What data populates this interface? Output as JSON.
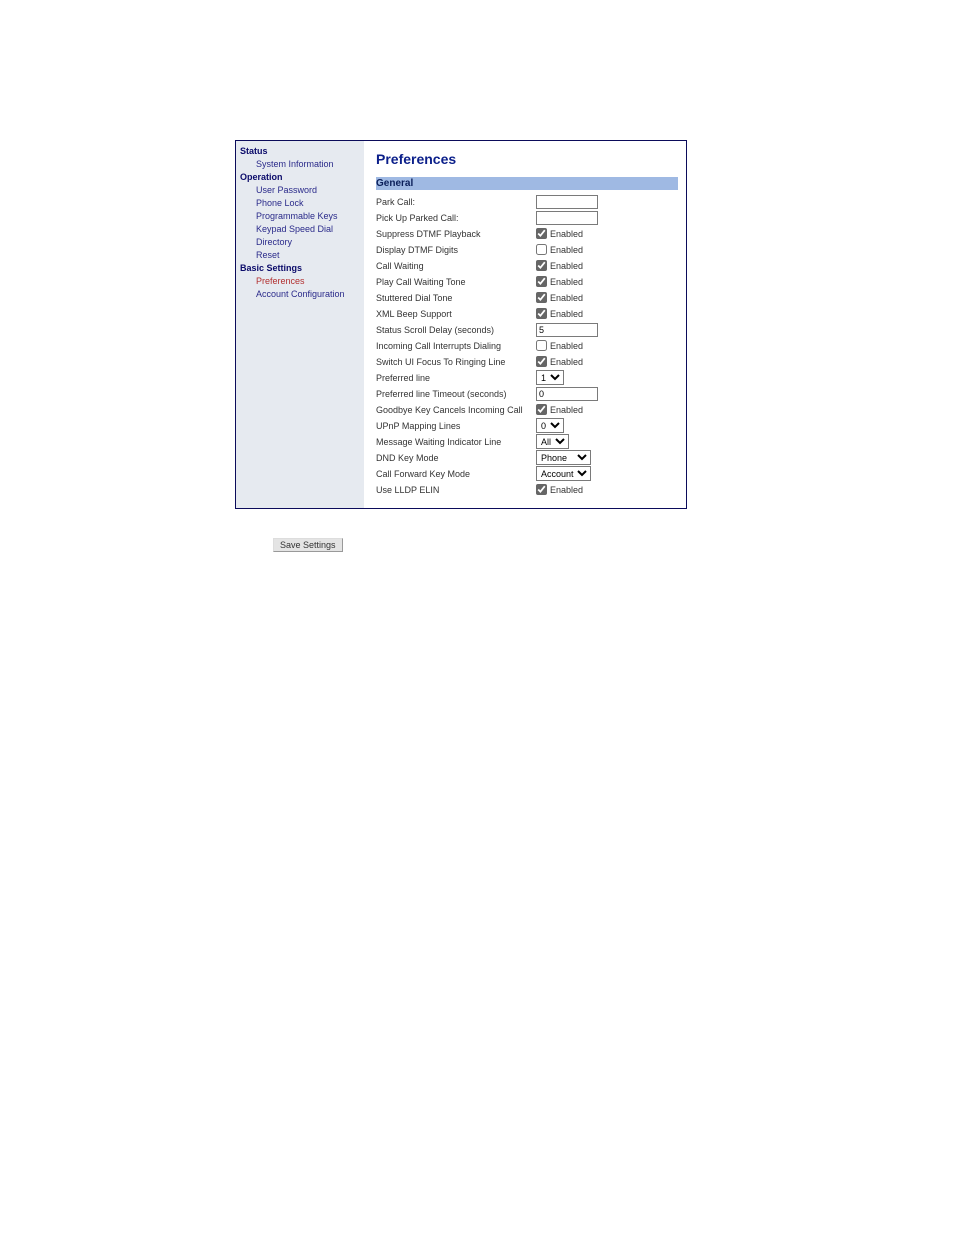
{
  "sidebar": {
    "sections": [
      {
        "type": "header",
        "label": "Status"
      },
      {
        "type": "item",
        "label": "System Information"
      },
      {
        "type": "header",
        "label": "Operation"
      },
      {
        "type": "item",
        "label": "User Password"
      },
      {
        "type": "item",
        "label": "Phone Lock"
      },
      {
        "type": "item",
        "label": "Programmable Keys"
      },
      {
        "type": "item",
        "label": "Keypad Speed Dial"
      },
      {
        "type": "item",
        "label": "Directory"
      },
      {
        "type": "item",
        "label": "Reset"
      },
      {
        "type": "header",
        "label": "Basic Settings"
      },
      {
        "type": "item",
        "label": "Preferences",
        "selected": true
      },
      {
        "type": "item",
        "label": "Account Configuration"
      }
    ]
  },
  "page_title": "Preferences",
  "section_title": "General",
  "rows": {
    "park_call": {
      "label": "Park Call:",
      "value": ""
    },
    "pick_up": {
      "label": "Pick Up Parked Call:",
      "value": ""
    },
    "suppress_dtmf": {
      "label": "Suppress DTMF Playback",
      "checked": true,
      "text": "Enabled"
    },
    "display_dtmf": {
      "label": "Display DTMF Digits",
      "checked": false,
      "text": "Enabled"
    },
    "call_waiting": {
      "label": "Call Waiting",
      "checked": true,
      "text": "Enabled"
    },
    "play_cw_tone": {
      "label": "Play Call Waiting Tone",
      "checked": true,
      "text": "Enabled"
    },
    "stuttered": {
      "label": "Stuttered Dial Tone",
      "checked": true,
      "text": "Enabled"
    },
    "xml_beep": {
      "label": "XML Beep Support",
      "checked": true,
      "text": "Enabled"
    },
    "status_scroll": {
      "label": "Status Scroll Delay (seconds)",
      "value": "5"
    },
    "incoming_interrupts": {
      "label": "Incoming Call Interrupts Dialing",
      "checked": false,
      "text": "Enabled"
    },
    "switch_focus": {
      "label": "Switch UI Focus To Ringing Line",
      "checked": true,
      "text": "Enabled"
    },
    "preferred_line": {
      "label": "Preferred line",
      "value": "1"
    },
    "preferred_timeout": {
      "label": "Preferred line Timeout (seconds)",
      "value": "0"
    },
    "goodbye_cancels": {
      "label": "Goodbye Key Cancels Incoming Call",
      "checked": true,
      "text": "Enabled"
    },
    "upnp": {
      "label": "UPnP Mapping Lines",
      "value": "0"
    },
    "mwi_line": {
      "label": "Message Waiting Indicator Line",
      "value": "All"
    },
    "dnd_mode": {
      "label": "DND Key Mode",
      "value": "Phone"
    },
    "cfwd_mode": {
      "label": "Call Forward Key Mode",
      "value": "Account"
    },
    "lldp": {
      "label": "Use LLDP ELIN",
      "checked": true,
      "text": "Enabled"
    }
  },
  "save_button": "Save Settings"
}
